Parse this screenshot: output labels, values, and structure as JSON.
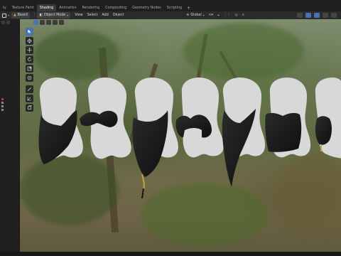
{
  "top_bar": {
    "tabs": [
      {
        "label": "ty",
        "active": false
      },
      {
        "label": "Texture Paint",
        "active": false
      },
      {
        "label": "Shading",
        "active": true
      },
      {
        "label": "Animation",
        "active": false
      },
      {
        "label": "Rendering",
        "active": false
      },
      {
        "label": "Compositing",
        "active": false
      },
      {
        "label": "Geometry Nodes",
        "active": false
      },
      {
        "label": "Scripting",
        "active": false
      }
    ],
    "add_tab": "+"
  },
  "header": {
    "object_name": "Beard",
    "mode": "Object Mode",
    "menus": [
      "View",
      "Select",
      "Add",
      "Object"
    ],
    "transform_orientation": "Global"
  },
  "outliner": {
    "rows": [
      "",
      "",
      "",
      ""
    ]
  },
  "viewport": {
    "models": [
      {
        "name": "head-full-beard-1",
        "beard": "full"
      },
      {
        "name": "head-mustache",
        "beard": "mustache"
      },
      {
        "name": "head-long-braided-beard",
        "beard": "braided"
      },
      {
        "name": "head-horseshoe-mustache",
        "beard": "horseshoe"
      },
      {
        "name": "head-long-pointed-beard",
        "beard": "pointed"
      },
      {
        "name": "head-square-beard",
        "beard": "square"
      },
      {
        "name": "head-short-braid",
        "beard": "short-braid"
      }
    ]
  },
  "colors": {
    "accent": "#4772b3",
    "head": "#d8d8d8",
    "hair": "#1a1a1a"
  }
}
